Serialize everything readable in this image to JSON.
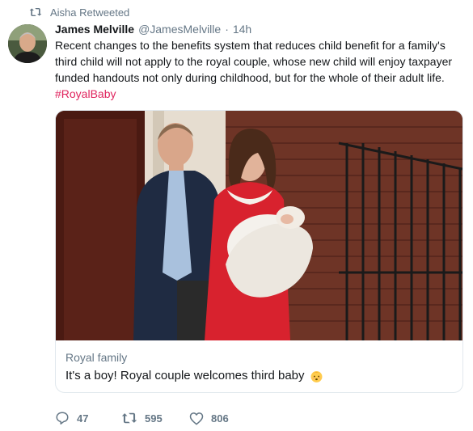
{
  "retweet_context": {
    "text": "Aisha Retweeted"
  },
  "tweet": {
    "author_name": "James Melville",
    "author_handle": "@JamesMelville",
    "separator": "·",
    "time": "14h",
    "text": "Recent changes to the benefits system that reduces child benefit for a family's third child will not apply to the royal couple, whose new child will enjoy taxpayer funded handouts not only during childhood, but for the whole of their adult life.",
    "hashtag": "#RoyalBaby"
  },
  "card": {
    "domain": "Royal family",
    "title": "It's a boy! Royal couple welcomes third baby",
    "title_emoji": "baby-emoji-icon"
  },
  "actions": {
    "reply_count": "47",
    "retweet_count": "595",
    "like_count": "806"
  },
  "colors": {
    "text": "#14171a",
    "secondary": "#657786",
    "hashtag": "#e0245e",
    "border": "#e1e8ed"
  }
}
